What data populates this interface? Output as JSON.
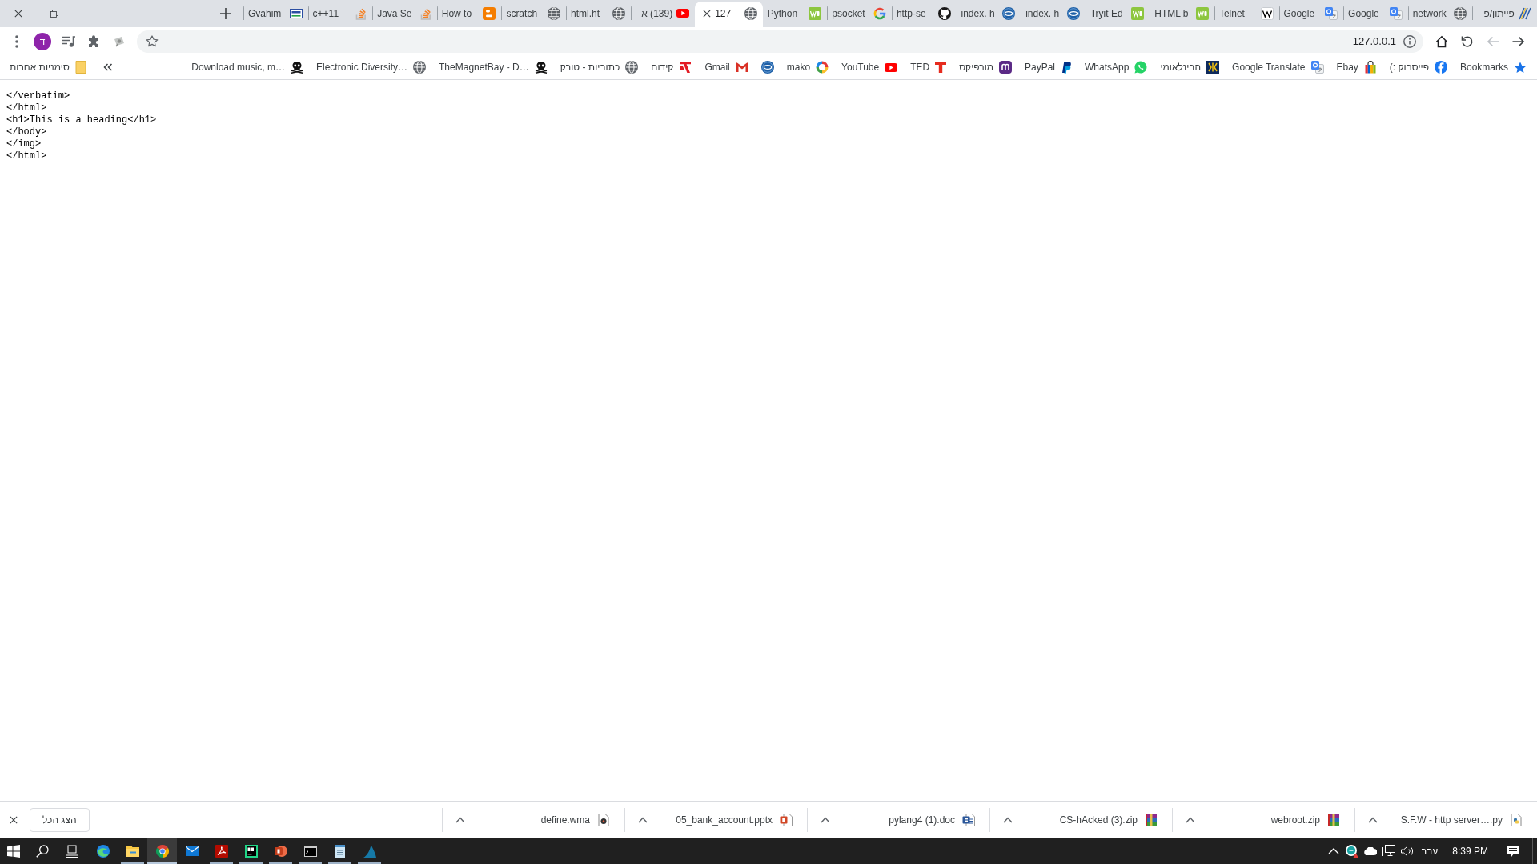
{
  "tabs": [
    {
      "title": "Gvahim",
      "kind": "gvahim",
      "selected": false
    },
    {
      "title": "c++11",
      "kind": "stack",
      "selected": false
    },
    {
      "title": "Java Se",
      "kind": "stack",
      "selected": false
    },
    {
      "title": "How to",
      "kind": "blogger",
      "selected": false
    },
    {
      "title": "scratch",
      "kind": "globe",
      "selected": false
    },
    {
      "title": "html.ht",
      "kind": "globe",
      "selected": false
    },
    {
      "title": "(139) א",
      "kind": "youtube",
      "selected": false
    },
    {
      "title": "127",
      "kind": "globe",
      "selected": true
    },
    {
      "title": "Python",
      "kind": "w3",
      "selected": false
    },
    {
      "title": "psocket",
      "kind": "google",
      "selected": false
    },
    {
      "title": "http-se",
      "kind": "github",
      "selected": false
    },
    {
      "title": "index. h",
      "kind": "fxp",
      "selected": false
    },
    {
      "title": "index. h",
      "kind": "fxp",
      "selected": false
    },
    {
      "title": "Tryit Ed",
      "kind": "w3",
      "selected": false
    },
    {
      "title": "HTML b",
      "kind": "w3",
      "selected": false
    },
    {
      "title": "Telnet –",
      "kind": "wiki",
      "selected": false
    },
    {
      "title": "Google",
      "kind": "translate",
      "selected": false
    },
    {
      "title": "Google",
      "kind": "translate",
      "selected": false
    },
    {
      "title": "network",
      "kind": "globe",
      "selected": false
    },
    {
      "title": "פייתון/פ",
      "kind": "pylogo",
      "selected": false
    }
  ],
  "toolbar": {
    "profile_initial": "ד",
    "address": "127.0.0.1",
    "forward": {
      "disabled": true
    },
    "back": {
      "disabled": false
    }
  },
  "bookmarks_bar": {
    "other_bookmarks": "סימניות אחרות",
    "items": [
      {
        "title": "Download music, m…",
        "kind": "skull"
      },
      {
        "title": "Electronic Diversity…",
        "kind": "globe"
      },
      {
        "title": "TheMagnetBay - D…",
        "kind": "skull"
      },
      {
        "title": "כתוביות - טורק",
        "kind": "globe"
      },
      {
        "title": "קידום",
        "kind": "kidum"
      },
      {
        "title": "Gmail",
        "kind": "gmail"
      },
      {
        "kind": "fxp"
      },
      {
        "title": "mako",
        "kind": "mako"
      },
      {
        "title": "YouTube",
        "kind": "youtube"
      },
      {
        "title": "TED",
        "kind": "ted"
      },
      {
        "title": "מורפיקס",
        "kind": "morfix"
      },
      {
        "title": "PayPal",
        "kind": "paypal"
      },
      {
        "title": "WhatsApp",
        "kind": "whatsapp"
      },
      {
        "title": "הבינלאומי",
        "kind": "intl"
      },
      {
        "title": "Google Translate",
        "kind": "translate"
      },
      {
        "title": "Ebay",
        "kind": "ebay"
      },
      {
        "title": "פייסבוק :)",
        "kind": "facebook"
      },
      {
        "title": "Bookmarks",
        "kind": "star"
      }
    ]
  },
  "page": {
    "lines": [
      "</verbatim>",
      "</html>",
      "<h1>This is a heading</h1>",
      "</body>",
      "</img>",
      "</html>"
    ]
  },
  "download_shelf": {
    "show_all": "הצג הכל",
    "downloads": [
      {
        "name": "define.wma",
        "kind": "audio"
      },
      {
        "name": "05_bank_account.pptx",
        "kind": "pptx"
      },
      {
        "name": "pylang4 (1).doc",
        "kind": "doc"
      },
      {
        "name": "CS-hAcked (3).zip",
        "kind": "zip"
      },
      {
        "name": "webroot.zip",
        "kind": "zip"
      },
      {
        "name": "S.F.W - http server….py",
        "kind": "py"
      }
    ]
  },
  "taskbar": {
    "apps": [
      {
        "kind": "edge",
        "running": false,
        "selected": false
      },
      {
        "kind": "explorer",
        "running": true,
        "selected": false
      },
      {
        "kind": "chrome",
        "running": true,
        "selected": true
      },
      {
        "kind": "mail",
        "running": false,
        "selected": false
      },
      {
        "kind": "acrobat",
        "running": true,
        "selected": false
      },
      {
        "kind": "pycharm",
        "running": true,
        "selected": false
      },
      {
        "kind": "powerpoint",
        "running": true,
        "selected": false
      },
      {
        "kind": "cmd",
        "running": true,
        "selected": false
      },
      {
        "kind": "notepad",
        "running": true,
        "selected": false
      },
      {
        "kind": "wireshark",
        "running": true,
        "selected": false
      }
    ],
    "language": "עבר",
    "time": "8:39 PM"
  }
}
